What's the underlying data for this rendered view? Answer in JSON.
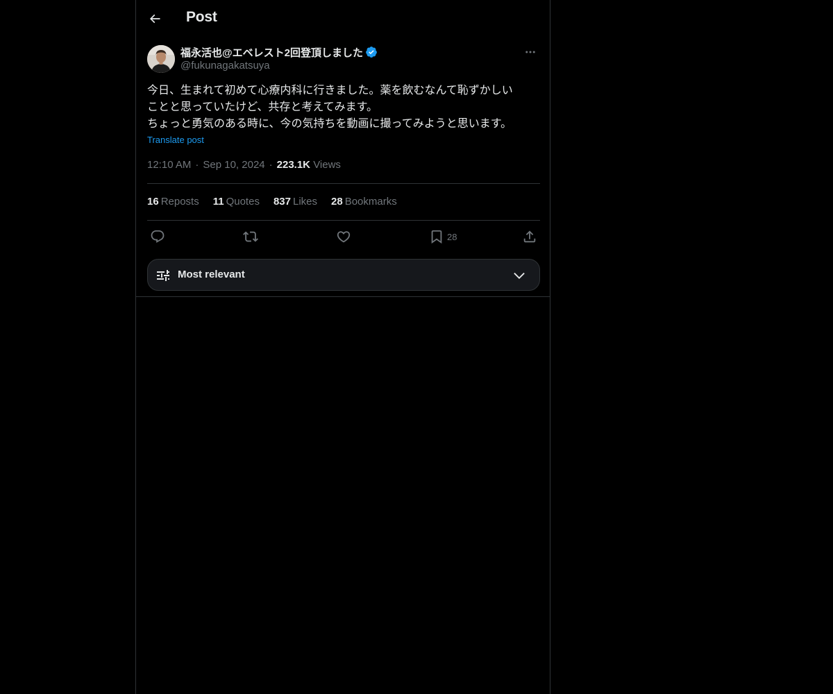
{
  "header": {
    "title": "Post"
  },
  "post": {
    "author": {
      "display_name": "福永活也@エベレスト2回登頂しました",
      "handle": "@fukunagakatsuya",
      "verified": true
    },
    "text_lines": [
      "今日、生まれて初めて心療内科に行きました。薬を飲むなんて恥ずかしい",
      "ことと思っていたけど、共存と考えてみます。",
      "ちょっと勇気のある時に、今の気持ちを動画に撮ってみようと思います。"
    ],
    "translate_label": "Translate post",
    "time": "12:10 AM",
    "date": "Sep 10, 2024",
    "separator": "·",
    "views_count": "223.1K",
    "views_label": "Views"
  },
  "stats": {
    "reposts": {
      "count": "16",
      "label": "Reposts"
    },
    "quotes": {
      "count": "11",
      "label": "Quotes"
    },
    "likes": {
      "count": "837",
      "label": "Likes"
    },
    "bookmarks": {
      "count": "28",
      "label": "Bookmarks"
    }
  },
  "actions": {
    "reply_icon": "reply-icon",
    "repost_icon": "repost-icon",
    "like_icon": "heart-icon",
    "bookmark_icon": "bookmark-icon",
    "bookmark_count": "28",
    "share_icon": "share-icon"
  },
  "sort": {
    "label": "Most relevant"
  },
  "colors": {
    "background": "#000000",
    "text": "#e7e9ea",
    "muted": "#71767b",
    "accent": "#1d9bf0",
    "border": "#2f3336"
  }
}
